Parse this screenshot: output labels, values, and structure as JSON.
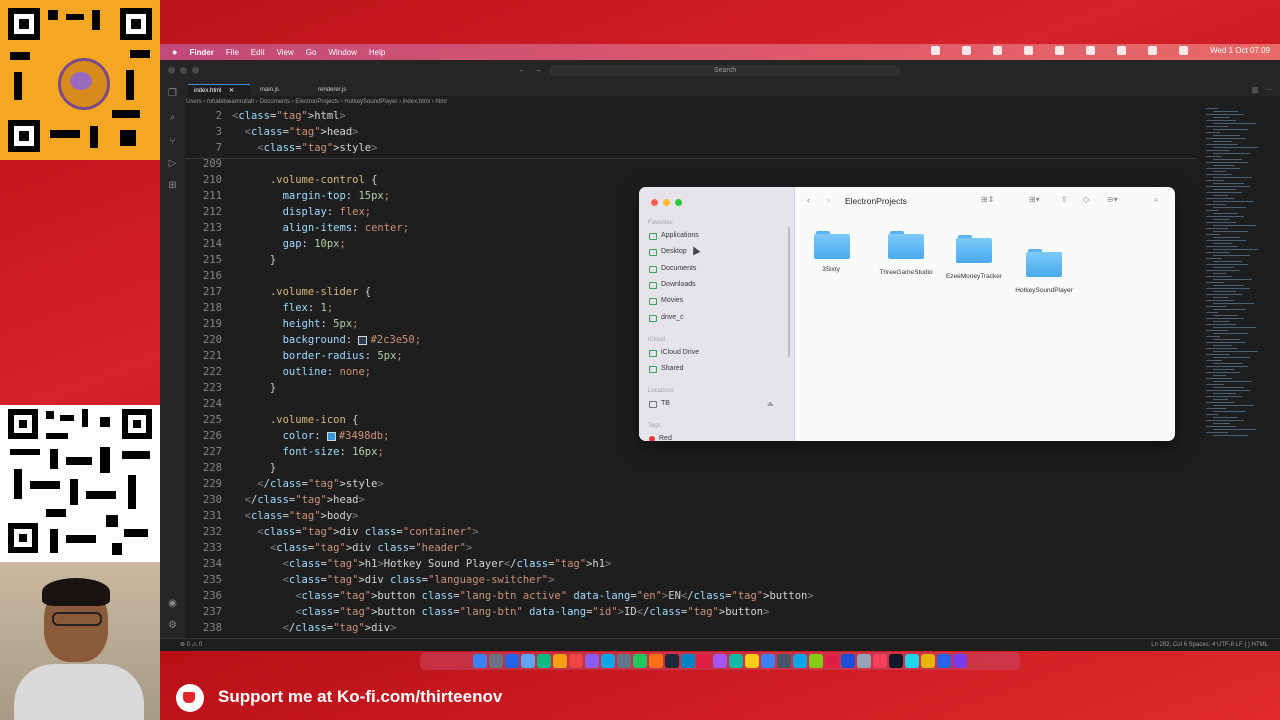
{
  "menubar": {
    "app": "Finder",
    "items": [
      "File",
      "Edit",
      "View",
      "Go",
      "Window",
      "Help"
    ],
    "clock": "Wed 1 Oct 07.09"
  },
  "window": {
    "search_placeholder": "Search"
  },
  "tabs": [
    {
      "label": "index.html",
      "active": true
    },
    {
      "label": "main.js",
      "active": false
    },
    {
      "label": "renderer.js",
      "active": false
    }
  ],
  "breadcrumb": "Users › mhabibieamrullah › Documents › ElectronProjects › HotkeySoundPlayer › index.html › html",
  "code": [
    {
      "n": "2",
      "t": "<html>"
    },
    {
      "n": "3",
      "t": "  <head>"
    },
    {
      "n": "7",
      "t": "    <style>"
    },
    {
      "n": "209",
      "t": ""
    },
    {
      "n": "210",
      "t": "      .volume-control {"
    },
    {
      "n": "211",
      "t": "        margin-top: 15px;"
    },
    {
      "n": "212",
      "t": "        display: flex;"
    },
    {
      "n": "213",
      "t": "        align-items: center;"
    },
    {
      "n": "214",
      "t": "        gap: 10px;"
    },
    {
      "n": "215",
      "t": "      }"
    },
    {
      "n": "216",
      "t": ""
    },
    {
      "n": "217",
      "t": "      .volume-slider {"
    },
    {
      "n": "218",
      "t": "        flex: 1;"
    },
    {
      "n": "219",
      "t": "        height: 5px;"
    },
    {
      "n": "220",
      "t": "        background: #2c3e50;"
    },
    {
      "n": "221",
      "t": "        border-radius: 5px;"
    },
    {
      "n": "222",
      "t": "        outline: none;"
    },
    {
      "n": "223",
      "t": "      }"
    },
    {
      "n": "224",
      "t": ""
    },
    {
      "n": "225",
      "t": "      .volume-icon {"
    },
    {
      "n": "226",
      "t": "        color: #3498db;"
    },
    {
      "n": "227",
      "t": "        font-size: 16px;"
    },
    {
      "n": "228",
      "t": "      }"
    },
    {
      "n": "229",
      "t": "    </style>"
    },
    {
      "n": "230",
      "t": "  </head>"
    },
    {
      "n": "231",
      "t": "  <body>"
    },
    {
      "n": "232",
      "t": "    <div class=\"container\">"
    },
    {
      "n": "233",
      "t": "      <div class=\"header\">"
    },
    {
      "n": "234",
      "t": "        <h1>Hotkey Sound Player</h1>"
    },
    {
      "n": "235",
      "t": "        <div class=\"language-switcher\">"
    },
    {
      "n": "236",
      "t": "          <button class=\"lang-btn active\" data-lang=\"en\">EN</button>"
    },
    {
      "n": "237",
      "t": "          <button class=\"lang-btn\" data-lang=\"id\">ID</button>"
    },
    {
      "n": "238",
      "t": "        </div>"
    }
  ],
  "colors": {
    "swatch_220": "#2c3e50",
    "swatch_226": "#3498db",
    "accent": "#3a8ee6"
  },
  "statusbar": {
    "left": "⊗ 0 ⚠ 0",
    "right": "Ln 282, Col 6   Spaces: 4   UTF-8   LF   { } HTML"
  },
  "finder": {
    "title": "ElectronProjects",
    "sections": {
      "favorites": "Favorites",
      "icloud": "iCloud",
      "locations": "Locations",
      "tags": "Tags"
    },
    "favorites": [
      "Applications",
      "Desktop",
      "Documents",
      "Downloads",
      "Movies",
      "drive_c"
    ],
    "icloud_items": [
      "iCloud Drive",
      "Shared"
    ],
    "locations": [
      "TB"
    ],
    "tags": [
      "Red"
    ],
    "folders": [
      "3Sixty",
      "ThreeGameStudio",
      "EzeeMoneyTracker",
      "HotkeySoundPlayer"
    ]
  },
  "kofi": {
    "text": "Support me at Ko-fi.com/thirteenov"
  }
}
